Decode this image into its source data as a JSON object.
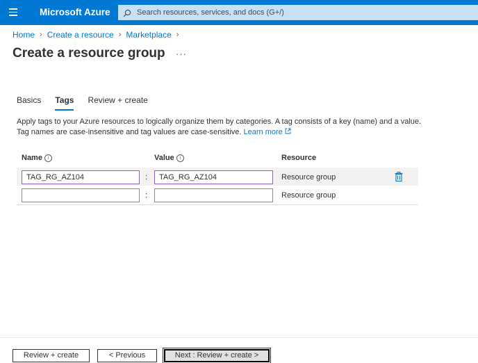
{
  "header": {
    "brand": "Microsoft Azure",
    "search_placeholder": "Search resources, services, and docs (G+/)"
  },
  "breadcrumb": [
    "Home",
    "Create a resource",
    "Marketplace"
  ],
  "page": {
    "title": "Create a resource group",
    "more": "···"
  },
  "tabs": [
    {
      "label": "Basics",
      "active": false
    },
    {
      "label": "Tags",
      "active": true
    },
    {
      "label": "Review + create",
      "active": false
    }
  ],
  "description": {
    "text": "Apply tags to your Azure resources to logically organize them by categories. A tag consists of a key (name) and a value. Tag names are case-insensitive and tag values are case-sensitive.",
    "link": "Learn more"
  },
  "table": {
    "headers": {
      "name": "Name",
      "value": "Value",
      "resource": "Resource"
    },
    "separator": ":",
    "rows": [
      {
        "name": "TAG_RG_AZ104",
        "value": "TAG_RG_AZ104",
        "resource": "Resource group"
      },
      {
        "name": "",
        "value": "",
        "resource": "Resource group"
      }
    ]
  },
  "footer": {
    "review": "Review + create",
    "previous": "< Previous",
    "next": "Next : Review + create >"
  },
  "colors": {
    "accent": "#0078d4",
    "highlight_border": "#8764b8"
  }
}
